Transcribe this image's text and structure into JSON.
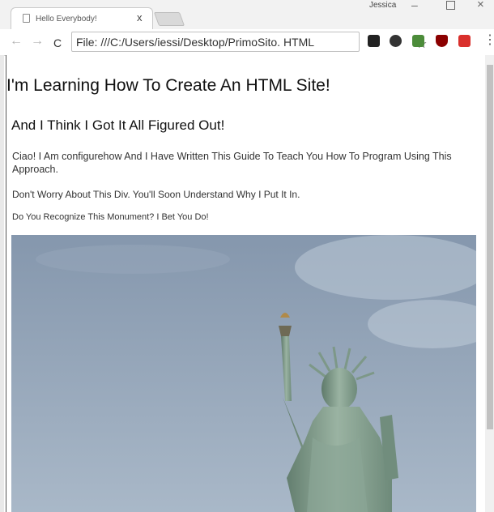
{
  "browser": {
    "tab_title": "Hello Everybody!",
    "tab_close": "x",
    "user_name": "Jessica",
    "address_prefix": "C",
    "address": "File: ///C:/Users/iessi/Desktop/PrimoSito. HTML"
  },
  "page": {
    "heading1": "I'm Learning How To Create An HTML Site!",
    "heading2": "And I Think I Got It All Figured Out!",
    "intro": "Ciao! I Am  configurehow And I Have Written This Guide To Teach You How To Program Using This Approach.",
    "div_note": "Don't Worry About This Div. You'll Soon Understand Why I Put It In.",
    "monument_question": "Do You Recognize This Monument? I Bet You Do!"
  },
  "icons": [
    "file-icon",
    "back-arrow-icon",
    "forward-arrow-icon",
    "star-icon",
    "evernote-icon",
    "extension-icon",
    "extension-icon",
    "ublock-icon",
    "extension-icon",
    "menu-icon"
  ],
  "colors": {
    "sky": "#8fa2b8",
    "statue_green": "#7f9a8a",
    "ublock_red": "#8b0000",
    "red_ext": "#d9302c"
  }
}
